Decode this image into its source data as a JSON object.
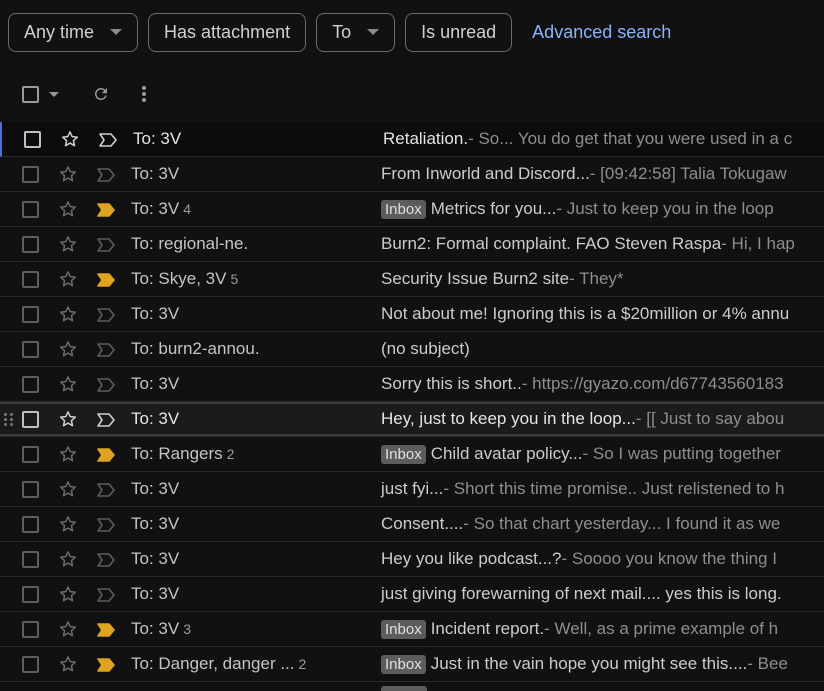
{
  "filters": {
    "any_time": "Any time",
    "has_attachment": "Has attachment",
    "to": "To",
    "is_unread": "Is unread",
    "advanced_search": "Advanced search"
  },
  "toolbar": {
    "select_icon": "checkbox-icon",
    "refresh_icon": "refresh-icon",
    "more_icon": "more-vert-icon"
  },
  "colors": {
    "important_marker": "#e0a31f",
    "link": "#8ab4f8",
    "selected_accent": "#4a6fd8"
  },
  "emails": [
    {
      "sender": "To: 3V",
      "count": "",
      "badge": "",
      "subject": "Retaliation.",
      "snippet": " - So... You do get that you were used in a c",
      "important": false,
      "state": "selected"
    },
    {
      "sender": "To: 3V",
      "count": "",
      "badge": "",
      "subject": "From Inworld and Discord...",
      "snippet": " - [09:42:58] Talia Tokugaw",
      "important": false,
      "state": ""
    },
    {
      "sender": "To: 3V",
      "count": "4",
      "badge": "Inbox",
      "subject": "Metrics for you...",
      "snippet": " - Just to keep you in the loop",
      "important": true,
      "state": ""
    },
    {
      "sender": "To: regional-ne.",
      "count": "",
      "badge": "",
      "subject": "Burn2: Formal complaint. FAO Steven Raspa",
      "snippet": " - Hi, I hap",
      "important": false,
      "state": ""
    },
    {
      "sender": "To: Skye, 3V",
      "count": "5",
      "badge": "",
      "subject": "Security Issue Burn2 site",
      "snippet": " - They*",
      "important": true,
      "state": ""
    },
    {
      "sender": "To: 3V",
      "count": "",
      "badge": "",
      "subject": "Not about me! Ignoring this is a $20million or 4% annu",
      "snippet": "",
      "important": false,
      "state": ""
    },
    {
      "sender": "To: burn2-annou.",
      "count": "",
      "badge": "",
      "subject": "(no subject)",
      "snippet": "",
      "important": false,
      "state": ""
    },
    {
      "sender": "To: 3V",
      "count": "",
      "badge": "",
      "subject": "Sorry this is short..",
      "snippet": " - https://gyazo.com/d67743560183",
      "important": false,
      "state": ""
    },
    {
      "sender": "To: 3V",
      "count": "",
      "badge": "",
      "subject": "Hey, just to keep you in the loop...",
      "snippet": " - [[ Just to say abou",
      "important": false,
      "state": "hover"
    },
    {
      "sender": "To: Rangers",
      "count": "2",
      "badge": "Inbox",
      "subject": "Child avatar policy...",
      "snippet": " - So I was putting together",
      "important": true,
      "state": ""
    },
    {
      "sender": "To: 3V",
      "count": "",
      "badge": "",
      "subject": "just fyi...",
      "snippet": " - Short this time promise.. Just relistened to h",
      "important": false,
      "state": ""
    },
    {
      "sender": "To: 3V",
      "count": "",
      "badge": "",
      "subject": "Consent....",
      "snippet": " - So that chart yesterday... I found it as we",
      "important": false,
      "state": ""
    },
    {
      "sender": "To: 3V",
      "count": "",
      "badge": "",
      "subject": "Hey you like podcast...?",
      "snippet": " - Soooo you know the thing I",
      "important": false,
      "state": ""
    },
    {
      "sender": "To: 3V",
      "count": "",
      "badge": "",
      "subject": "just giving forewarning of next mail.... yes this is long.",
      "snippet": "",
      "important": false,
      "state": ""
    },
    {
      "sender": "To: 3V",
      "count": "3",
      "badge": "Inbox",
      "subject": "Incident report.",
      "snippet": " - Well, as a prime example of h",
      "important": true,
      "state": ""
    },
    {
      "sender": "To: Danger, danger ...",
      "count": "2",
      "badge": "Inbox",
      "subject": "Just in the vain hope you might see this....",
      "snippet": " - Bee",
      "important": true,
      "state": ""
    }
  ]
}
